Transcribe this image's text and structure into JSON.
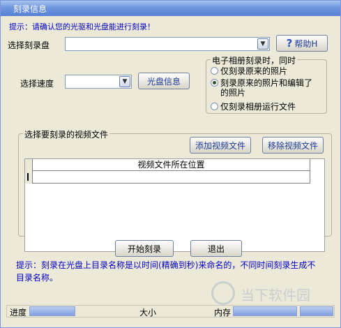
{
  "window": {
    "title": "刻录信息"
  },
  "hint_top": "提示：请确认您的光驱和光盘能进行刻录！",
  "disc": {
    "label": "选择刻录盘",
    "value": ""
  },
  "help_button": {
    "label": "帮助H"
  },
  "speed": {
    "label": "选择速度",
    "value": ""
  },
  "disc_info_button": {
    "label": "光盘信息"
  },
  "album_group": {
    "title": "电子相册刻录时，同时",
    "options": [
      {
        "label": "仅刻录原来的照片",
        "checked": false
      },
      {
        "label": "刻录原来的照片和编辑了的照片",
        "checked": true
      },
      {
        "label": "仅刻录相册运行文件",
        "checked": false
      }
    ]
  },
  "video_group": {
    "title": "选择要刻录的视频文件"
  },
  "add_video_button": {
    "label": "添加视频文件"
  },
  "remove_video_button": {
    "label": "移除视频文件"
  },
  "table": {
    "columns": [
      "视频文件所在位置"
    ],
    "rows": [
      [
        ""
      ]
    ]
  },
  "start_button": {
    "label": "开始刻录"
  },
  "exit_button": {
    "label": "退出"
  },
  "hint_bottom": "提示：刻录在光盘上目录名称是以时间(精确到秒)来命名的，不同时间刻录生成不目录名称。",
  "status": {
    "progress_label": "进度",
    "size_label": "大小",
    "memory_label": "内存"
  },
  "watermark": {
    "text": "当下软件园"
  },
  "colors": {
    "hint": "#0000c8",
    "title_bar": "#6f97dd",
    "button_text": "#1d3b9a"
  }
}
